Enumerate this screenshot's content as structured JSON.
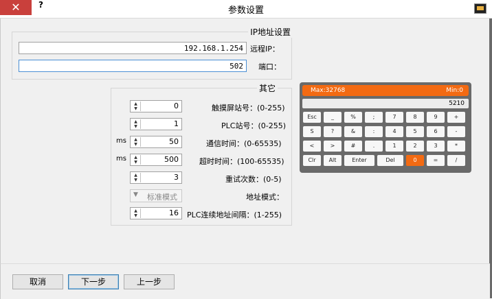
{
  "window": {
    "title": "参数设置",
    "close": "✕",
    "help": "?"
  },
  "ip_group": {
    "title": "IP地址设置",
    "remote_ip_label": "远程IP：",
    "remote_ip_value": "192.168.1.254",
    "port_label": "端口：",
    "port_value": "502"
  },
  "other_group": {
    "title": "其它",
    "rows": [
      {
        "label": "触摸屏站号：(0-255)",
        "value": "0",
        "unit": ""
      },
      {
        "label": "PLC站号：(0-255)",
        "value": "1",
        "unit": ""
      },
      {
        "label": "通信时间：(0-65535)",
        "value": "50",
        "unit": "ms"
      },
      {
        "label": "超时时间：(100-65535)",
        "value": "500",
        "unit": "ms"
      },
      {
        "label": "重试次数：(0-5)",
        "value": "3",
        "unit": ""
      }
    ],
    "addr_mode_label": "地址模式：",
    "addr_mode_value": "标准模式",
    "plc_interval_label": "PLC连续地址间隔：(1-255)",
    "plc_interval_value": "16"
  },
  "keypad": {
    "min": "Min:0",
    "max": "Max:32768",
    "input": "5210",
    "rows": [
      [
        "Esc",
        "_",
        "%",
        ";",
        "7",
        "8",
        "9",
        "+"
      ],
      [
        "S",
        "?",
        "&",
        ":",
        "4",
        "5",
        "6",
        "-"
      ],
      [
        "<",
        ">",
        "#",
        ".",
        "1",
        "2",
        "3",
        "*"
      ],
      [
        "Clr",
        "Alt",
        "Enter",
        "Del",
        "0",
        "=",
        "/"
      ]
    ],
    "accent": "#f36a12"
  },
  "footer": {
    "cancel": "取消",
    "next": "下一步",
    "prev": "上一步"
  }
}
